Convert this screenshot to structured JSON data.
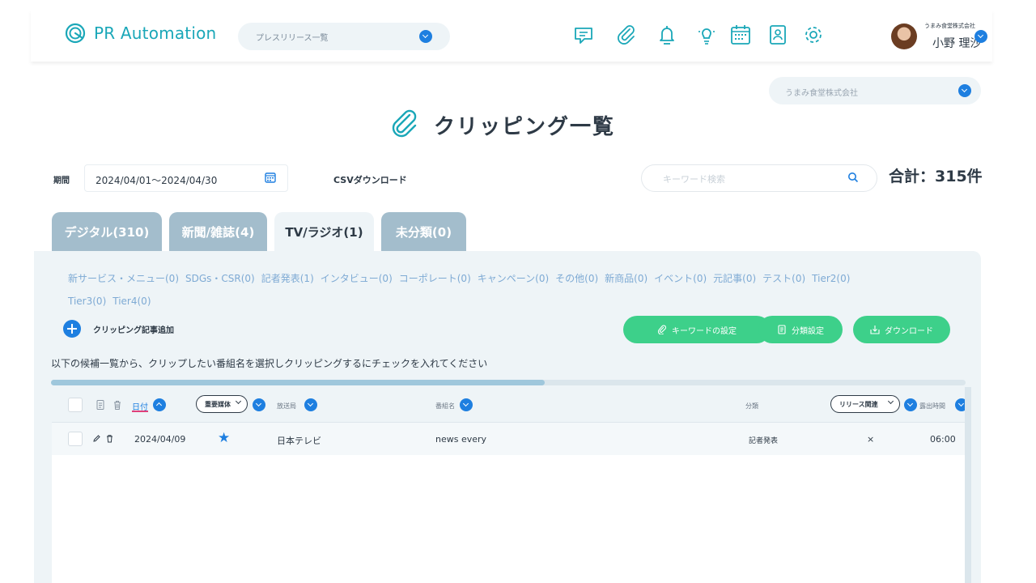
{
  "app": {
    "logo_text": "PR Automation",
    "press_select": "プレスリリース一覧"
  },
  "user": {
    "company": "うまみ食堂株式会社",
    "name": "小野 理沙"
  },
  "company_select": "うまみ食堂株式会社",
  "page": {
    "title": "クリッピング一覧"
  },
  "filters": {
    "period_label": "期間",
    "period_value": "2024/04/01〜2024/04/30",
    "csv_download": "CSVダウンロード",
    "search_placeholder": "キーワード検索",
    "total": "合計：315件"
  },
  "tabs": [
    {
      "label": "デジタル(310)",
      "active": false
    },
    {
      "label": "新聞/雑誌(4)",
      "active": false
    },
    {
      "label": "TV/ラジオ(1)",
      "active": true
    },
    {
      "label": "未分類(0)",
      "active": false
    }
  ],
  "categories": [
    "新サービス・メニュー(0)",
    "SDGs・CSR(0)",
    "記者発表(1)",
    "インタビュー(0)",
    "コーポレート(0)",
    "キャンペーン(0)",
    "その他(0)",
    "新商品(0)",
    "イベント(0)",
    "元記事(0)",
    "テスト(0)",
    "Tier2(0)",
    "Tier3(0)",
    "Tier4(0)"
  ],
  "actions": {
    "add_clipping": "クリッピング記事追加",
    "keyword_settings": "キーワードの設定",
    "category_settings": "分類設定",
    "download": "ダウンロード"
  },
  "instruction": "以下の候補一覧から、クリップしたい番組名を選択しクリッピングするにチェックを入れてください",
  "table": {
    "scroll_fraction": 0.54,
    "headers": {
      "date": "日付",
      "important_media": "重要媒体",
      "station": "放送局",
      "program": "番組名",
      "category": "分類",
      "release_related": "リリース関連",
      "exposure_time": "露出時間"
    },
    "rows": [
      {
        "date": "2024/04/09",
        "starred": true,
        "station": "日本テレビ",
        "program": "news every",
        "category": "記者発表",
        "release_related": "×",
        "exposure_time": "06:00"
      }
    ]
  },
  "colors": {
    "accent": "#1e7fe0",
    "teal": "#1aa7b8",
    "green": "#3dd08a",
    "tab_inactive": "#a3bdcc",
    "panel": "#eef4f7"
  },
  "icons": [
    "chat-icon",
    "paperclip-icon",
    "bell-icon",
    "lightbulb-icon",
    "calendar-icon",
    "contact-icon",
    "gear-icon"
  ]
}
